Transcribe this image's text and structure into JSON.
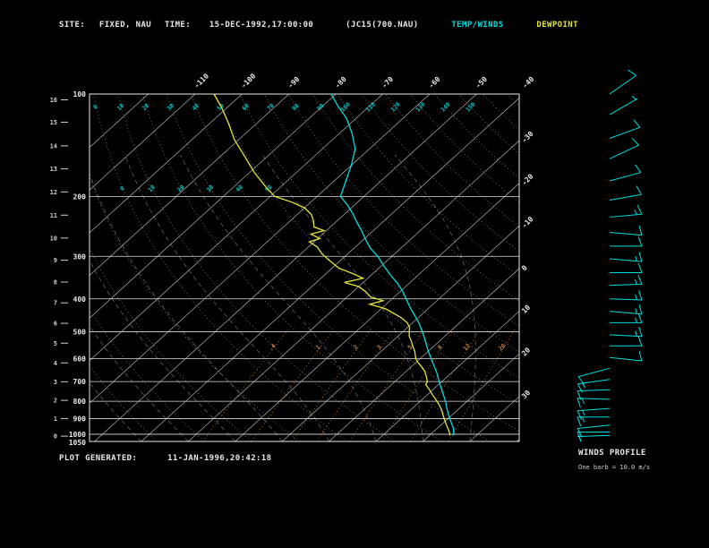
{
  "header": {
    "site_label": "SITE:",
    "site_value": "FIXED, NAU",
    "time_label": "TIME:",
    "time_value": "15-DEC-1992,17:00:00",
    "dataset": "(JC15(700.NAU)",
    "legend_temp": "TEMP/WINDS",
    "legend_dew": "DEWPOINT"
  },
  "footer": {
    "label": "PLOT GENERATED:",
    "value": "11-JAN-1996,20:42:18"
  },
  "winds_panel": {
    "title": "WINDS PROFILE",
    "legend": "One barb = 10.0 m/s"
  },
  "colors": {
    "background": "#000000",
    "frame": "#e8e8e8",
    "isobar": "#dcdcdc",
    "isotherm": "#b0b0b0",
    "adiabat": "#8c8c8c",
    "moist_adiabat": "#6e6e6e",
    "mixing_ratio": "#c08038",
    "adiabat_label": "#00c8c8",
    "axis_label": "#e8e8e8",
    "height_label": "#cfcfcf",
    "temp_trace": "#00dede",
    "dew_trace": "#e3e33c",
    "barb": "#00dede"
  },
  "chart_data": {
    "type": "skewt-logp",
    "title": "Skew-T log-P sounding, FIXED NAU 15-DEC-1992 17:00:00",
    "pressure_hpa_range": [
      100,
      1050
    ],
    "pressure_ticks_hpa": [
      100,
      200,
      300,
      400,
      500,
      600,
      700,
      800,
      900,
      1000,
      1050
    ],
    "height_km_pressure": [
      [
        0,
        1013
      ],
      [
        1,
        899
      ],
      [
        2,
        795
      ],
      [
        3,
        701
      ],
      [
        4,
        617
      ],
      [
        5,
        540
      ],
      [
        6,
        472
      ],
      [
        7,
        411
      ],
      [
        8,
        357
      ],
      [
        9,
        308
      ],
      [
        10,
        265
      ],
      [
        11,
        227
      ],
      [
        12,
        194
      ],
      [
        13,
        166
      ],
      [
        14,
        142
      ],
      [
        15,
        121
      ],
      [
        16,
        104
      ]
    ],
    "top_temp_labels_c": [
      -110,
      -100,
      -90,
      -80,
      -70,
      -60,
      -50,
      -40
    ],
    "right_temp_labels_c": [
      -30,
      -20,
      -10,
      0,
      10,
      20,
      30
    ],
    "isotherms_c": [
      -120,
      -110,
      -100,
      -90,
      -80,
      -70,
      -60,
      -50,
      -40,
      -30,
      -20,
      -10,
      0,
      10,
      20,
      30,
      40
    ],
    "dry_adiabats_c": [
      -40,
      -30,
      -20,
      -10,
      0,
      10,
      20,
      30,
      40,
      50,
      60,
      70,
      80,
      90,
      100,
      110,
      120,
      130,
      140,
      150,
      160,
      170,
      180,
      190,
      200
    ],
    "dry_adiabat_label_rows": [
      {
        "y": 121,
        "min": 0,
        "max": 150
      },
      {
        "y": 212,
        "min": -10,
        "max": 50
      }
    ],
    "moist_adiabats_c": [
      -40,
      -30,
      -20,
      -10,
      0,
      10,
      20,
      30
    ],
    "mixing_ratio_g_kg": [
      0.4,
      1,
      2,
      3,
      5,
      8,
      12,
      20
    ],
    "mixing_ratio_label_p": 560,
    "barb_full_mps": 10,
    "series": [
      {
        "name": "TEMP",
        "color_key": "temp_trace",
        "points_p_c": [
          [
            100,
            -81
          ],
          [
            108,
            -77
          ],
          [
            118,
            -72
          ],
          [
            130,
            -67.5
          ],
          [
            145,
            -63
          ],
          [
            162,
            -60
          ],
          [
            180,
            -57.5
          ],
          [
            200,
            -55
          ],
          [
            212,
            -51.5
          ],
          [
            224,
            -48.5
          ],
          [
            238,
            -45.5
          ],
          [
            252,
            -42.5
          ],
          [
            268,
            -39.5
          ],
          [
            284,
            -36.5
          ],
          [
            300,
            -33
          ],
          [
            320,
            -29.5
          ],
          [
            340,
            -26
          ],
          [
            360,
            -22.5
          ],
          [
            380,
            -19.5
          ],
          [
            400,
            -17
          ],
          [
            425,
            -14
          ],
          [
            450,
            -11
          ],
          [
            475,
            -8.2
          ],
          [
            500,
            -5.8
          ],
          [
            525,
            -3.6
          ],
          [
            550,
            -1.6
          ],
          [
            575,
            0.4
          ],
          [
            600,
            2.4
          ],
          [
            630,
            4.7
          ],
          [
            660,
            6.9
          ],
          [
            700,
            9.4
          ],
          [
            730,
            11.3
          ],
          [
            760,
            13.1
          ],
          [
            800,
            15.4
          ],
          [
            830,
            16.9
          ],
          [
            860,
            18.4
          ],
          [
            900,
            20.4
          ],
          [
            930,
            21.9
          ],
          [
            960,
            23.4
          ],
          [
            1000,
            24.9
          ],
          [
            1008,
            25.2
          ]
        ]
      },
      {
        "name": "DEWPOINT",
        "color_key": "dew_trace",
        "points_p_c": [
          [
            100,
            -106
          ],
          [
            110,
            -101
          ],
          [
            122,
            -96
          ],
          [
            136,
            -91
          ],
          [
            152,
            -85
          ],
          [
            170,
            -79
          ],
          [
            188,
            -73
          ],
          [
            200,
            -69
          ],
          [
            208,
            -64
          ],
          [
            216,
            -60
          ],
          [
            226,
            -57
          ],
          [
            236,
            -55
          ],
          [
            246,
            -53.5
          ],
          [
            252,
            -50.5
          ],
          [
            258,
            -52.5
          ],
          [
            266,
            -49.5
          ],
          [
            272,
            -51
          ],
          [
            282,
            -48
          ],
          [
            295,
            -45.5
          ],
          [
            310,
            -42
          ],
          [
            325,
            -38.5
          ],
          [
            338,
            -34
          ],
          [
            348,
            -31
          ],
          [
            358,
            -34
          ],
          [
            368,
            -30
          ],
          [
            380,
            -27.5
          ],
          [
            395,
            -25
          ],
          [
            405,
            -21.5
          ],
          [
            415,
            -23.5
          ],
          [
            428,
            -19
          ],
          [
            440,
            -16.5
          ],
          [
            455,
            -13.5
          ],
          [
            470,
            -11.2
          ],
          [
            485,
            -9.6
          ],
          [
            500,
            -8.6
          ],
          [
            515,
            -7.6
          ],
          [
            530,
            -6.2
          ],
          [
            550,
            -4.6
          ],
          [
            570,
            -2.9
          ],
          [
            600,
            -0.9
          ],
          [
            615,
            0.4
          ],
          [
            630,
            1.9
          ],
          [
            650,
            3.7
          ],
          [
            670,
            5.1
          ],
          [
            700,
            6.9
          ],
          [
            715,
            7.3
          ],
          [
            735,
            8.9
          ],
          [
            760,
            10.7
          ],
          [
            790,
            12.9
          ],
          [
            820,
            14.9
          ],
          [
            850,
            16.7
          ],
          [
            880,
            18.2
          ],
          [
            910,
            19.7
          ],
          [
            940,
            21.2
          ],
          [
            970,
            22.7
          ],
          [
            1000,
            24.1
          ],
          [
            1008,
            24.3
          ]
        ]
      }
    ],
    "winds_p_dir_mps": [
      [
        100,
        55,
        10
      ],
      [
        115,
        60,
        8
      ],
      [
        135,
        70,
        10
      ],
      [
        155,
        65,
        12
      ],
      [
        180,
        75,
        10
      ],
      [
        205,
        80,
        12
      ],
      [
        230,
        85,
        15
      ],
      [
        255,
        95,
        12
      ],
      [
        280,
        90,
        10
      ],
      [
        305,
        95,
        15
      ],
      [
        335,
        90,
        12
      ],
      [
        365,
        88,
        15
      ],
      [
        400,
        92,
        17
      ],
      [
        435,
        95,
        15
      ],
      [
        470,
        90,
        17
      ],
      [
        510,
        93,
        15
      ],
      [
        550,
        90,
        12
      ],
      [
        595,
        96,
        10
      ],
      [
        640,
        255,
        10
      ],
      [
        690,
        262,
        15
      ],
      [
        740,
        268,
        12
      ],
      [
        790,
        272,
        15
      ],
      [
        840,
        266,
        17
      ],
      [
        890,
        270,
        15
      ],
      [
        940,
        264,
        12
      ],
      [
        985,
        270,
        10
      ],
      [
        1008,
        268,
        8
      ]
    ]
  }
}
